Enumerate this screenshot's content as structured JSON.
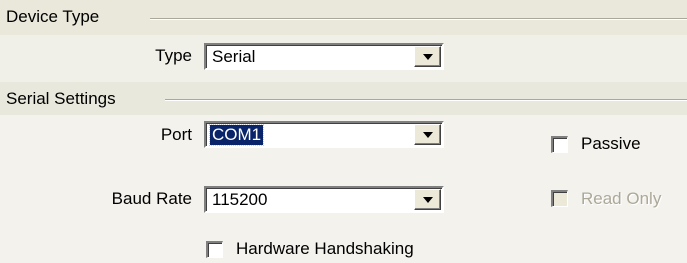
{
  "device_type_group": {
    "title": "Device Type",
    "type_label": "Type",
    "type_value": "Serial"
  },
  "serial_settings_group": {
    "title": "Serial Settings",
    "port_label": "Port",
    "port_value": "COM1",
    "baud_rate_label": "Baud Rate",
    "baud_rate_value": "115200",
    "passive_label": "Passive",
    "passive_checked": false,
    "read_only_label": "Read Only",
    "read_only_checked": false,
    "read_only_enabled": false,
    "hardware_handshaking_label": "Hardware Handshaking",
    "hardware_handshaking_checked": false
  },
  "icons": {
    "combo_dropdown": "chevron-down-icon"
  },
  "colors": {
    "dialog_background": "#ece9d8",
    "selection_highlight": "#0a246a",
    "disabled_text": "#aca899"
  }
}
